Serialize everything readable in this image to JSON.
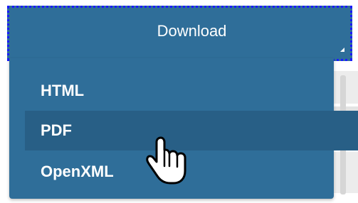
{
  "download_button": {
    "label": "Download"
  },
  "menu": {
    "items": [
      {
        "label": "HTML"
      },
      {
        "label": "PDF"
      },
      {
        "label": "OpenXML"
      }
    ],
    "hovered_item": "PDF"
  },
  "colors": {
    "menu_background": "#2f6e99",
    "hover_background": "#285f86",
    "focus_outline": "#1a1aff",
    "text": "#ffffff"
  },
  "cursor": {
    "icon": "hand-pointer-icon"
  }
}
